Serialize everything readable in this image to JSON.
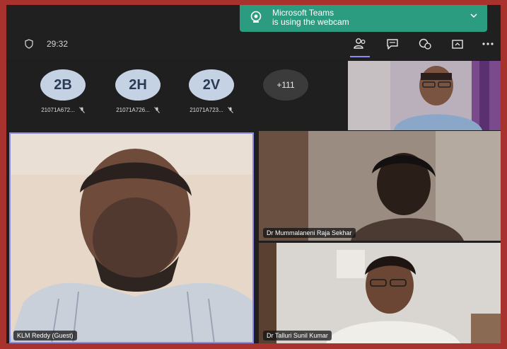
{
  "toast": {
    "line1": "Microsoft Teams",
    "line2": "is using the webcam"
  },
  "toolbar": {
    "timer": "29:32",
    "icons": [
      "participants-icon",
      "chat-icon",
      "reactions-icon",
      "share-tray-icon",
      "more-options-icon"
    ]
  },
  "participants_strip": [
    {
      "initials": "2B",
      "name": "21071A672..."
    },
    {
      "initials": "2H",
      "name": "21071A726..."
    },
    {
      "initials": "2V",
      "name": "21071A723..."
    }
  ],
  "overflow_count": "+111",
  "tiles": {
    "main_speaker": "KLM Reddy (Guest)",
    "participant_middle": "Dr Mummalaneni Raja Sekhar",
    "participant_bottom": "Dr Talluri Sunil Kumar"
  },
  "colors": {
    "outer_frame": "#a8322e",
    "toast": "#2c9c80",
    "active_speaker_border": "#8c8ce8",
    "avatar_bg": "#c4d2e4"
  }
}
